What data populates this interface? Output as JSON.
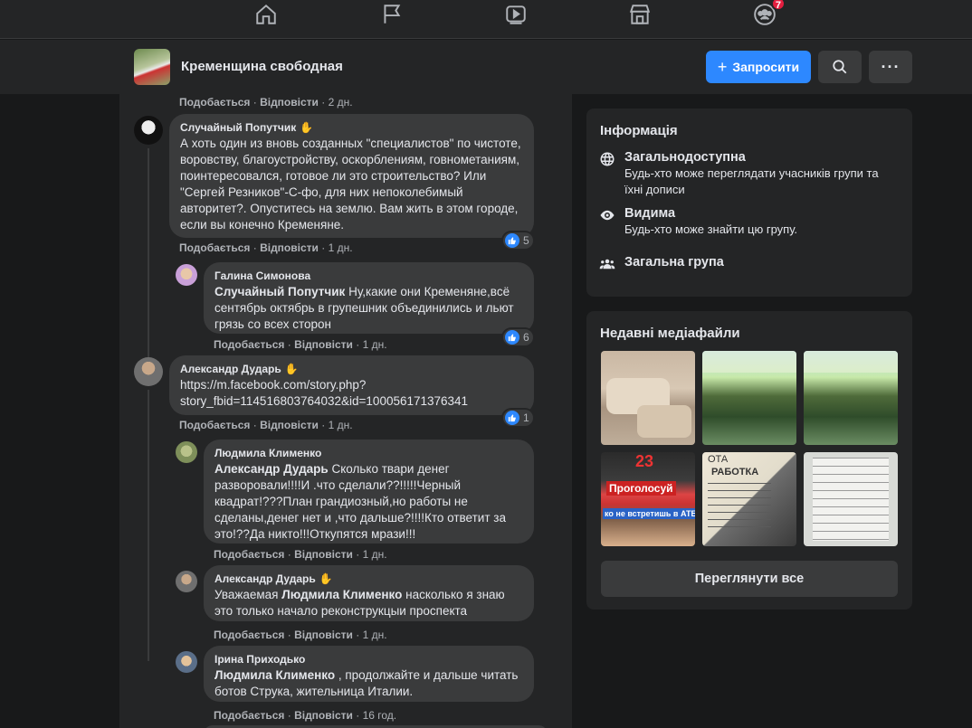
{
  "nav": {
    "items": [
      "home-icon",
      "pages-flag-icon",
      "watch-video-icon",
      "marketplace-icon",
      "groups-icon"
    ],
    "groups_badge": "7"
  },
  "group": {
    "name": "Кременщина свободная",
    "invite_label": "Запросити",
    "invite_icon": "+"
  },
  "comments": [
    {
      "meta": {
        "like": "Подобається",
        "reply": "Відповісти",
        "time": "2 дн."
      }
    },
    {
      "author": "Случайный Попутчик",
      "text": "А хоть один из вновь созданных \"специалистов\" по чистоте, воровству, благоустройству, оскорблениям, говнометаниям, поинтересовался, готовое ли это строительство? Или \"Сергей Резников\"-С-фо, для них непоколебимый авторитет?. Опуститесь на землю. Вам жить в этом городе, если вы конечно Кременяне.",
      "reactions": "5",
      "meta": {
        "like": "Подобається",
        "reply": "Відповісти",
        "time": "1 дн."
      }
    },
    {
      "author": "Галина Симонова",
      "mention": "Случайный Попутчик",
      "text": " Ну,какие они Кременяне,всё сентябрь октябрь в групешник объединились и льют грязь со всех сторон",
      "reactions": "6",
      "meta": {
        "like": "Подобається",
        "reply": "Відповісти",
        "time": "1 дн."
      }
    },
    {
      "author": "Александр Дударь",
      "text": "https://m.facebook.com/story.php?story_fbid=114516803764032&id=100056171376341",
      "text_line1": "https://m.facebook.com/story.php?",
      "text_line2": "story_fbid=114516803764032&id=100056171376341",
      "reactions": "1",
      "meta": {
        "like": "Подобається",
        "reply": "Відповісти",
        "time": "1 дн."
      }
    },
    {
      "author": "Людмила Клименко",
      "mention": "Александр Дударь",
      "text": " Сколько твари денег разворовали!!!!И .что сделали??!!!!!Черный квадрат!???План грандиозный,но работы не сделаны,денег нет и ,что дальше?!!!!Кто ответит за это!??Да никто!!!Откупятся мрази!!!",
      "meta": {
        "like": "Подобається",
        "reply": "Відповісти",
        "time": "1 дн."
      }
    },
    {
      "author": "Александр Дударь",
      "text_before": "Уважаемая ",
      "mention": "Людмила Клименко",
      "text": " насколько я знаю это только начало реконструкцыи проспекта",
      "meta": {
        "like": "Подобається",
        "reply": "Відповісти",
        "time": "1 дн."
      }
    },
    {
      "author": "Ірина Приходько",
      "mention": "Людмила Клименко",
      "text": " , продолжайте и дальше читать ботов Струка, жительница Италии.",
      "meta": {
        "like": "Подобається",
        "reply": "Відповісти",
        "time": "16 год."
      }
    }
  ],
  "info": {
    "title": "Інформація",
    "items": [
      {
        "icon": "globe-icon",
        "title": "Загальнодоступна",
        "desc": "Будь-хто може переглядати учасників групи та їхні дописи"
      },
      {
        "icon": "eye-icon",
        "title": "Видима",
        "desc": "Будь-хто може знайти цю групу."
      },
      {
        "icon": "people-icon",
        "title": "Загальна група"
      }
    ]
  },
  "media": {
    "title": "Недавні медіафайли",
    "overlay_text": [
      "23",
      "Проголосуй",
      "ко не встретишь в АТБ",
      "ОТА",
      "РАБОТКА"
    ],
    "see_all_label": "Переглянути все"
  },
  "colors": {
    "accent": "#2d88ff",
    "badge": "#e41e3f",
    "background": "#18191a",
    "surface": "#242526"
  }
}
